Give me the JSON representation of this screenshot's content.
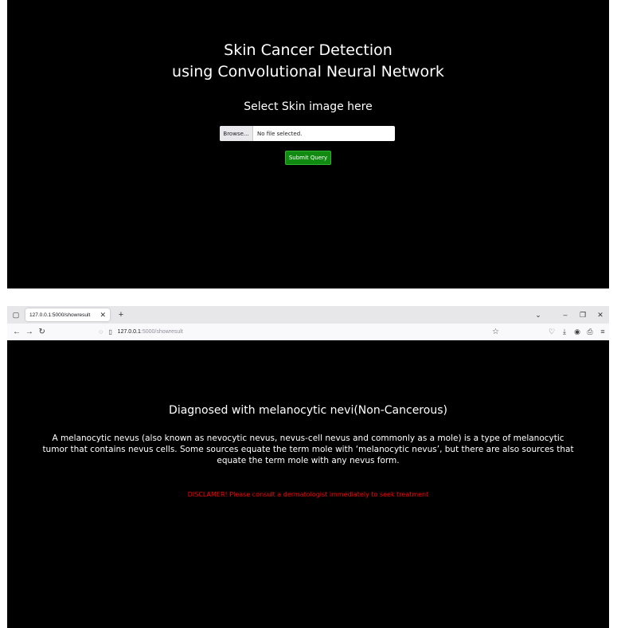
{
  "upload_page": {
    "title_line1": "Skin Cancer Detection",
    "title_line2": "using Convolutional Neural Network",
    "subtitle": "Select Skin image here",
    "browse_label": "Browse...",
    "file_status": "No file selected.",
    "submit_label": "Submit Query"
  },
  "browser": {
    "tab_title": "127.0.0.1:5000/showresult",
    "url_host": "127.0.0.1",
    "url_path": ":5000/showresult"
  },
  "result_page": {
    "diagnosis": "Diagnosed with melanocytic nevi(Non-Cancerous)",
    "description": "A melanocytic nevus (also known as nevocytic nevus, nevus-cell nevus and commonly as a mole) is a type of melanocytic tumor that contains nevus cells. Some sources equate the term mole with ‘melanocytic nevus’, but there are also sources that equate the term mole with any nevus form.",
    "disclaimer": "DISCLAMER! Please consult a dermatologist immediately to seek treatment"
  },
  "colors": {
    "background": "#000000",
    "submit_button": "#118a11",
    "disclaimer_text": "#ff0000"
  }
}
